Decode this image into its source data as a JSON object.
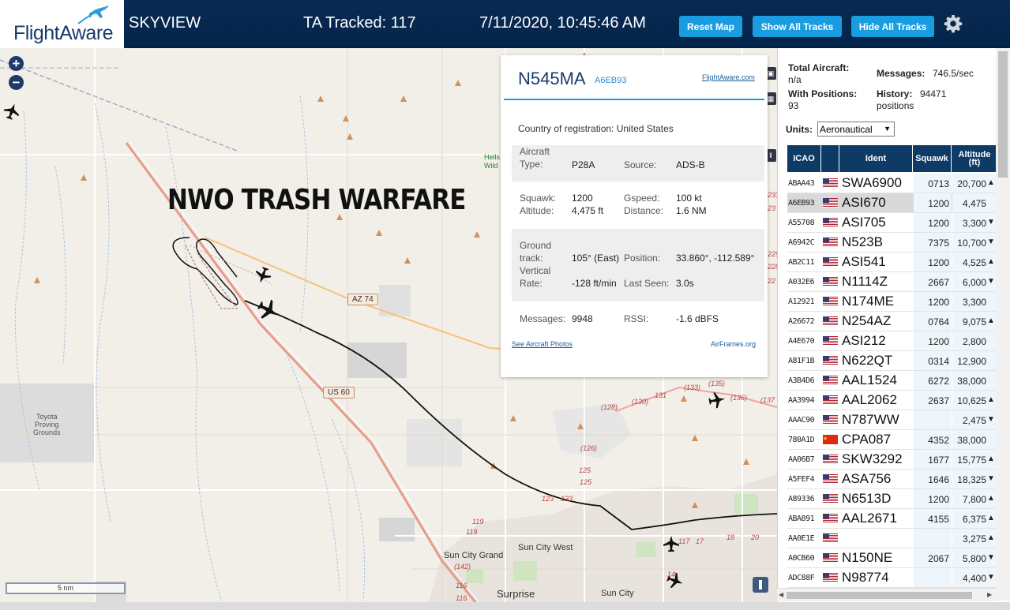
{
  "header": {
    "logo": "FlightAware",
    "app_title": "SKYVIEW",
    "ta_tracked": "TA Tracked: 117",
    "timestamp": "7/11/2020, 10:45:46 AM",
    "btn_reset": "Reset Map",
    "btn_show": "Show All Tracks",
    "btn_hide": "Hide All Tracks",
    "settings_icon": "gear-icon"
  },
  "map": {
    "zoom_in": "+",
    "zoom_out": "−",
    "scale": "5 nm",
    "overlay_text": "NWO TRASH WARFARE",
    "labels": {
      "toyota": "Toyota\nProving\nGrounds",
      "sun_city_grand": "Sun City Grand",
      "sun_city_west": "Sun City West",
      "surprise": "Surprise",
      "sun_city": "Sun City",
      "az74": "AZ 74",
      "us60": "US 60",
      "hells": "Hells\nWild"
    },
    "route_numbers": [
      "(128)",
      "(130)",
      "131",
      "(133)",
      "(135)",
      "(136)",
      "(137",
      "(126)",
      "125",
      "125",
      "123",
      "123",
      "119",
      "119",
      "(142)",
      "117",
      "116",
      "116",
      "14",
      "17",
      "18",
      "20",
      "233",
      "23",
      "229",
      "228",
      "22"
    ]
  },
  "popup": {
    "registration": "N545MA",
    "hex": "A6EB93",
    "fa_link": "FlightAware.com",
    "country_label": "Country of registration:",
    "country_value": "United States",
    "aircraft_type_label": "Aircraft\nType:",
    "aircraft_type_value": "P28A",
    "source_label": "Source:",
    "source_value": "ADS-B",
    "squawk_label": "Squawk:",
    "squawk_value": "1200",
    "gspeed_label": "Gspeed:",
    "gspeed_value": "100 kt",
    "altitude_label": "Altitude:",
    "altitude_value": "4,475 ft",
    "distance_label": "Distance:",
    "distance_value": "1.6 NM",
    "ground_track_label": "Ground\ntrack:",
    "ground_track_value": "105° (East)",
    "position_label": "Position:",
    "position_value": "33.860°, -112.589°",
    "vertical_rate_label": "Vertical\nRate:",
    "vertical_rate_value": "-128 ft/min",
    "last_seen_label": "Last Seen:",
    "last_seen_value": "3.0s",
    "messages_label": "Messages:",
    "messages_value": "9948",
    "rssi_label": "RSSI:",
    "rssi_value": "-1.6 dBFS",
    "photos_link": "See Aircraft Photos",
    "airframes_link": "AirFrames.org"
  },
  "panel": {
    "total_aircraft_label": "Total Aircraft:",
    "total_aircraft_value": "n/a",
    "messages_label": "Messages:",
    "messages_value": "746.5/sec",
    "with_positions_label": "With Positions:",
    "with_positions_value": "93",
    "history_label": "History:",
    "history_value": "94471",
    "history_unit": "positions",
    "units_label": "Units:",
    "units_value": "Aeronautical",
    "columns": [
      "ICAO",
      "Ident",
      "Squawk",
      "Altitude\n(ft)"
    ],
    "rows": [
      {
        "icao": "ABAA43",
        "flag": "us",
        "ident": "SWA6900",
        "squawk": "0713",
        "alt": "20,700",
        "arrow": "▲"
      },
      {
        "icao": "A6EB93",
        "flag": "us",
        "ident": "ASI670",
        "squawk": "1200",
        "alt": "4,475",
        "arrow": ""
      },
      {
        "icao": "A55708",
        "flag": "us",
        "ident": "ASI705",
        "squawk": "1200",
        "alt": "3,300",
        "arrow": "▼"
      },
      {
        "icao": "A6942C",
        "flag": "us",
        "ident": "N523B",
        "squawk": "7375",
        "alt": "10,700",
        "arrow": "▼"
      },
      {
        "icao": "AB2C11",
        "flag": "us",
        "ident": "ASI541",
        "squawk": "1200",
        "alt": "4,525",
        "arrow": "▲"
      },
      {
        "icao": "A032E6",
        "flag": "us",
        "ident": "N1114Z",
        "squawk": "2667",
        "alt": "6,000",
        "arrow": "▼"
      },
      {
        "icao": "A12921",
        "flag": "us",
        "ident": "N174ME",
        "squawk": "1200",
        "alt": "3,300",
        "arrow": ""
      },
      {
        "icao": "A26672",
        "flag": "us",
        "ident": "N254AZ",
        "squawk": "0764",
        "alt": "9,075",
        "arrow": "▲"
      },
      {
        "icao": "A4E670",
        "flag": "us",
        "ident": "ASI212",
        "squawk": "1200",
        "alt": "2,800",
        "arrow": ""
      },
      {
        "icao": "A81F1B",
        "flag": "us",
        "ident": "N622QT",
        "squawk": "0314",
        "alt": "12,900",
        "arrow": ""
      },
      {
        "icao": "A3B4D6",
        "flag": "us",
        "ident": "AAL1524",
        "squawk": "6272",
        "alt": "38,000",
        "arrow": ""
      },
      {
        "icao": "AA3994",
        "flag": "us",
        "ident": "AAL2062",
        "squawk": "2637",
        "alt": "10,625",
        "arrow": "▲"
      },
      {
        "icao": "AAAC90",
        "flag": "us",
        "ident": "N787WW",
        "squawk": "",
        "alt": "2,475",
        "arrow": "▼"
      },
      {
        "icao": "780A1D",
        "flag": "cn",
        "ident": "CPA087",
        "squawk": "4352",
        "alt": "38,000",
        "arrow": ""
      },
      {
        "icao": "AA06B7",
        "flag": "us",
        "ident": "SKW3292",
        "squawk": "1677",
        "alt": "15,775",
        "arrow": "▲"
      },
      {
        "icao": "A5FEF4",
        "flag": "us",
        "ident": "ASA756",
        "squawk": "1646",
        "alt": "18,325",
        "arrow": "▼"
      },
      {
        "icao": "A89336",
        "flag": "us",
        "ident": "N6513D",
        "squawk": "1200",
        "alt": "7,800",
        "arrow": "▲"
      },
      {
        "icao": "ABA891",
        "flag": "us",
        "ident": "AAL2671",
        "squawk": "4155",
        "alt": "6,375",
        "arrow": "▲"
      },
      {
        "icao": "AA0E1E",
        "flag": "us",
        "ident": "",
        "squawk": "",
        "alt": "3,275",
        "arrow": "▲"
      },
      {
        "icao": "A0CB60",
        "flag": "us",
        "ident": "N150NE",
        "squawk": "2067",
        "alt": "5,800",
        "arrow": "▼"
      },
      {
        "icao": "ADC88F",
        "flag": "us",
        "ident": "N98774",
        "squawk": "",
        "alt": "4,400",
        "arrow": "▼"
      }
    ]
  }
}
